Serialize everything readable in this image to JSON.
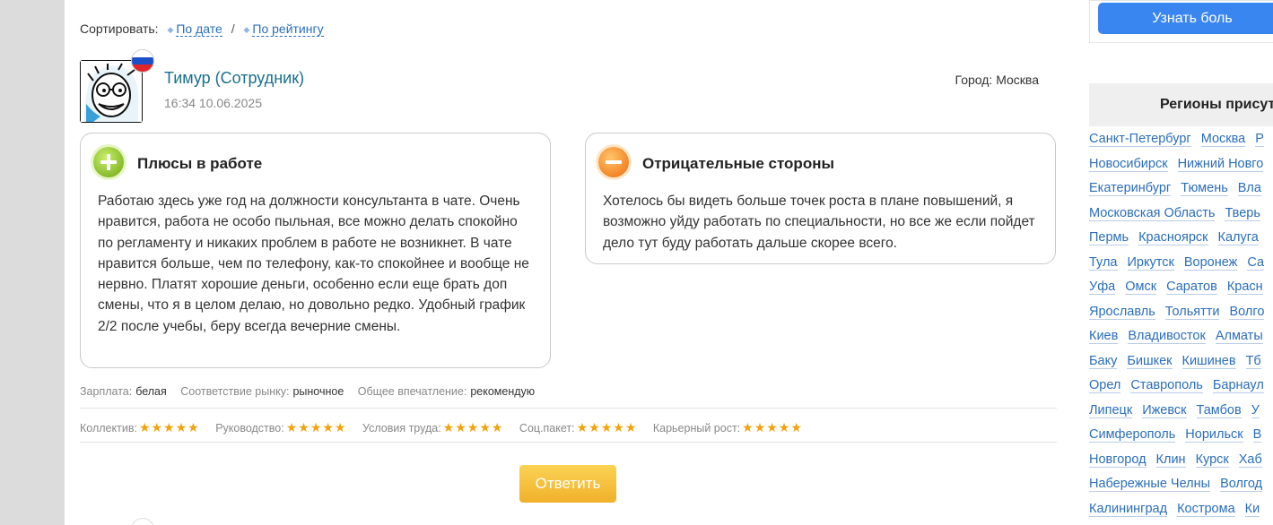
{
  "sort": {
    "label": "Сортировать:",
    "by_date": "По дате",
    "separator": "/",
    "by_rating": "По рейтингу"
  },
  "review": {
    "author": "Тимур (Сотрудник)",
    "date": "16:34 10.06.2025",
    "city": "Город: Москва",
    "pros": {
      "title": "Плюсы в работе",
      "text": "Работаю здесь уже год на должности консультанта в чате. Очень нравится, работа не особо пыльная, все можно делать спокойно по регламенту и никаких проблем в работе не возникнет. В чате нравится больше, чем по телефону, как-то спокойнее и вообще не нервно. Платят хорошие деньги, особенно если еще брать доп смены, что я в целом делаю, но довольно редко. Удобный график 2/2 после учебы, беру всегда вечерние смены."
    },
    "cons": {
      "title": "Отрицательные стороны",
      "text": "Хотелось бы видеть больше точек роста в плане повышений, я возможно уйду работать по специальности, но все же если пойдет дело тут буду работать дальше скорее всего."
    },
    "meta": [
      {
        "label": "Зарплата:",
        "value": "белая"
      },
      {
        "label": "Соответствие рынку:",
        "value": "рыночное"
      },
      {
        "label": "Общее впечатление:",
        "value": "рекомендую"
      }
    ],
    "ratings": [
      {
        "label": "Коллектив:",
        "stars": 5,
        "glyph": "★★★★★"
      },
      {
        "label": "Руководство:",
        "stars": 5,
        "glyph": "★★★★★"
      },
      {
        "label": "Условия труда:",
        "stars": 5,
        "glyph": "★★★★★"
      },
      {
        "label": "Соц.пакет:",
        "stars": 5,
        "glyph": "★★★★★"
      },
      {
        "label": "Карьерный рост:",
        "stars": 5,
        "glyph": "★★★★★"
      }
    ],
    "reply_label": "Ответить"
  },
  "sidebar": {
    "button_label": "Узнать боль",
    "regions_title": "Регионы присут",
    "regions": [
      [
        "Санкт-Петербург",
        "Москва",
        "Р"
      ],
      [
        "Новосибирск",
        "Нижний Новго"
      ],
      [
        "Екатеринбург",
        "Тюмень",
        "Вла"
      ],
      [
        "Московская Область",
        "Тверь"
      ],
      [
        "Пермь",
        "Красноярск",
        "Калуга"
      ],
      [
        "Тула",
        "Иркутск",
        "Воронеж",
        "Са"
      ],
      [
        "Уфа",
        "Омск",
        "Саратов",
        "Красн"
      ],
      [
        "Ярославль",
        "Тольятти",
        "Волго"
      ],
      [
        "Киев",
        "Владивосток",
        "Алматы"
      ],
      [
        "Баку",
        "Бишкек",
        "Кишинев",
        "Тб"
      ],
      [
        "Орел",
        "Ставрополь",
        "Барнаул"
      ],
      [
        "Липецк",
        "Ижевск",
        "Тамбов",
        "У"
      ],
      [
        "Симферополь",
        "Норильск",
        "В"
      ],
      [
        "Новгород",
        "Клин",
        "Курск",
        "Хаб"
      ],
      [
        "Набережные Челны",
        "Волгод"
      ],
      [
        "Калининград",
        "Кострома",
        "Ки"
      ]
    ]
  },
  "colors": {
    "link": "#2a6ebb",
    "author": "#1a6f8c",
    "star": "#f2a20a",
    "reply": "#f0b12b",
    "know_button": "#3a86f0"
  }
}
